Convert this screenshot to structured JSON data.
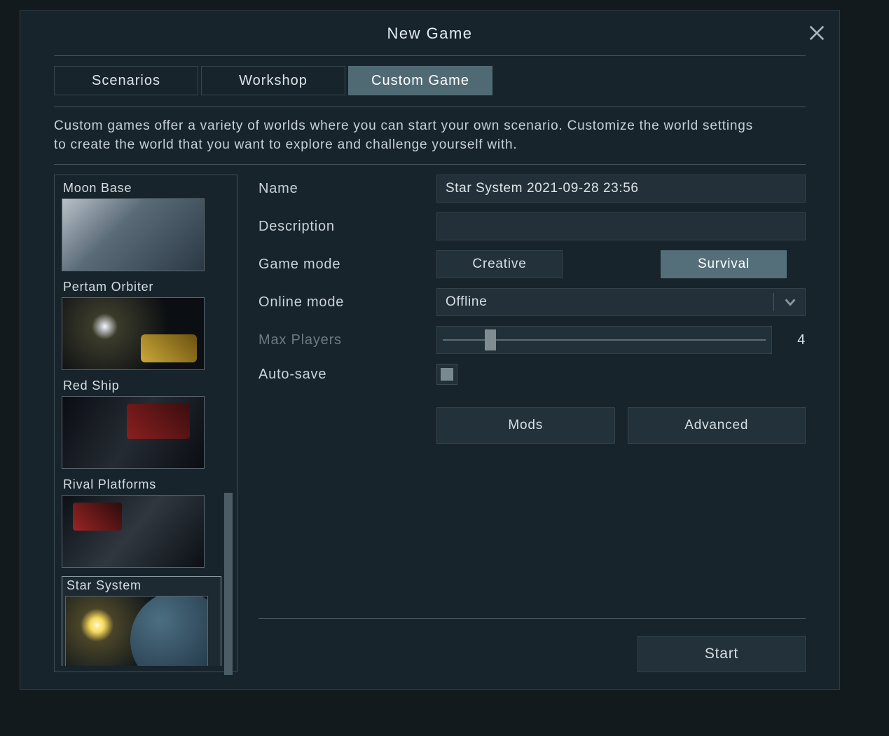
{
  "window": {
    "title": "New Game"
  },
  "tabs": [
    {
      "label": "Scenarios",
      "active": false
    },
    {
      "label": "Workshop",
      "active": false
    },
    {
      "label": "Custom Game",
      "active": true
    }
  ],
  "description": "Custom games offer a variety of worlds where you can start your own scenario. Customize the world settings to create the world that you want to explore and challenge yourself with.",
  "scenarios": [
    {
      "label": "Moon Base",
      "selected": false,
      "thumb": "moon"
    },
    {
      "label": "Pertam Orbiter",
      "selected": false,
      "thumb": "pertam"
    },
    {
      "label": "Red Ship",
      "selected": false,
      "thumb": "red"
    },
    {
      "label": "Rival Platforms",
      "selected": false,
      "thumb": "rival"
    },
    {
      "label": "Star System",
      "selected": true,
      "thumb": "star"
    }
  ],
  "form": {
    "name_label": "Name",
    "name_value": "Star System 2021-09-28 23:56",
    "description_label": "Description",
    "description_value": "",
    "gamemode_label": "Game mode",
    "gamemode_options": {
      "creative": "Creative",
      "survival": "Survival"
    },
    "gamemode_selected": "survival",
    "onlinemode_label": "Online mode",
    "onlinemode_value": "Offline",
    "maxplayers_label": "Max Players",
    "maxplayers_value": "4",
    "autosave_label": "Auto-save",
    "autosave_checked": true,
    "mods_label": "Mods",
    "advanced_label": "Advanced"
  },
  "footer": {
    "start_label": "Start"
  }
}
